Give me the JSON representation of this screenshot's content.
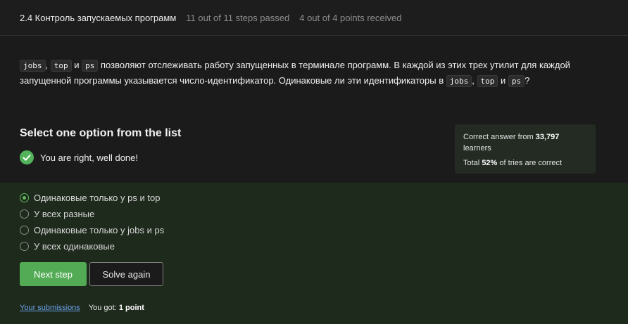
{
  "header": {
    "title": "2.4 Контроль запускаемых программ",
    "steps": "11 out of 11 steps passed",
    "points": "4 out of 4 points  received"
  },
  "question": {
    "code_jobs": "jobs",
    "code_top": "top",
    "code_ps": "ps",
    "sep_comma": ",",
    "word_and": "и",
    "text_part1": "позволяют отслеживать работу запущенных в терминале программ. В каждой из этих трех утилит для каждой запущенной программы указывается число-идентификатор. Одинаковые ли эти идентификаторы в",
    "text_end": "?"
  },
  "select_title": "Select one option from the list",
  "feedback": "You are right, well done!",
  "stats": {
    "correct_prefix": "Correct answer from",
    "learners_count": "33,797",
    "learners_suffix": "learners",
    "total_prefix": "Total",
    "percent": "52%",
    "total_suffix": "of tries are correct"
  },
  "options": [
    {
      "label": "Одинаковые только у ps и top",
      "selected": true
    },
    {
      "label": "У всех разные",
      "selected": false
    },
    {
      "label": "Одинаковые только у jobs и ps",
      "selected": false
    },
    {
      "label": "У всех одинаковые",
      "selected": false
    }
  ],
  "buttons": {
    "next": "Next step",
    "solve_again": "Solve again"
  },
  "footer": {
    "submissions_link": "Your submissions",
    "you_got": "You got:",
    "points": "1 point"
  },
  "colors": {
    "accent_green": "#53ac55",
    "link_blue": "#6aa0e8",
    "panel_green": "#1e2a1c"
  }
}
